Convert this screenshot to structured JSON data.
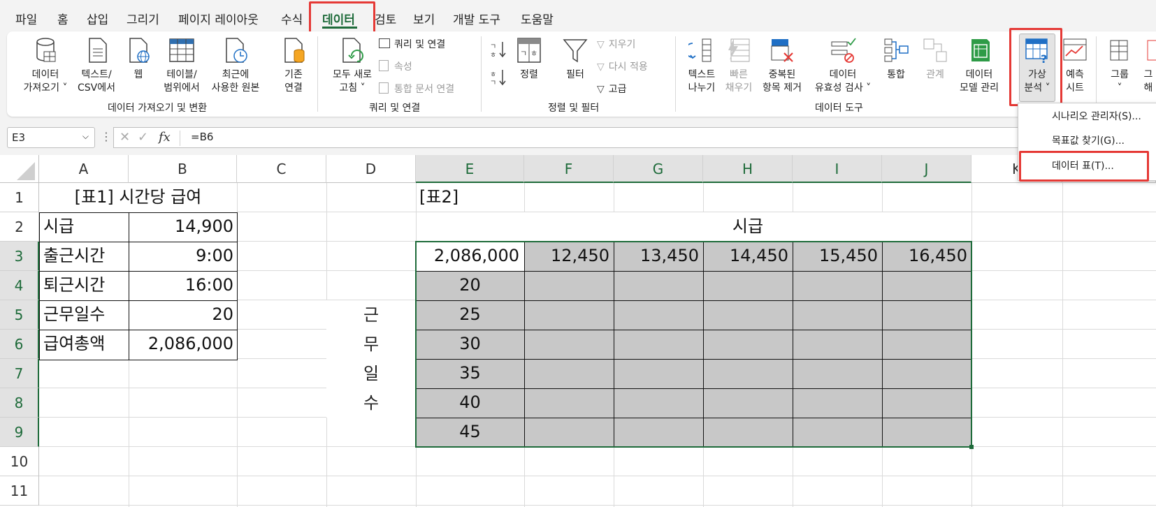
{
  "menu": {
    "tabs": [
      "파일",
      "홈",
      "삽입",
      "그리기",
      "페이지 레이아웃",
      "수식",
      "데이터",
      "검토",
      "보기",
      "개발 도구",
      "도움말"
    ],
    "active": "데이터"
  },
  "ribbon": {
    "get_data": {
      "l1": "데이터",
      "l2": "가져오기 ˅"
    },
    "text_csv": {
      "l1": "텍스트/",
      "l2": "CSV에서"
    },
    "web": {
      "l1": "웹"
    },
    "table_range": {
      "l1": "테이블/",
      "l2": "범위에서"
    },
    "recent": {
      "l1": "최근에",
      "l2": "사용한 원본"
    },
    "existing": {
      "l1": "기존",
      "l2": "연결"
    },
    "group1": "데이터 가져오기 및 변환",
    "refresh_all": {
      "l1": "모두 새로",
      "l2": "고침 ˅"
    },
    "queries": "쿼리 및 연결",
    "properties": "속성",
    "edit_links": "통합 문서 연결",
    "group2": "쿼리 및 연결",
    "sort": {
      "l1": "정렬"
    },
    "filter": {
      "l1": "필터"
    },
    "clear": "지우기",
    "reapply": "다시 적용",
    "advanced": "고급",
    "group3": "정렬 및 필터",
    "text_to_col": {
      "l1": "텍스트",
      "l2": "나누기"
    },
    "flash_fill": {
      "l1": "빠른",
      "l2": "채우기"
    },
    "remove_dup": {
      "l1": "중복된",
      "l2": "항목 제거"
    },
    "validation": {
      "l1": "데이터",
      "l2": "유효성 검사 ˅"
    },
    "consolidate": {
      "l1": "통합"
    },
    "relations": {
      "l1": "관계"
    },
    "data_model": {
      "l1": "데이터",
      "l2": "모델 관리"
    },
    "group4": "데이터 도구",
    "whatif": {
      "l1": "가상",
      "l2": "분석 ˅"
    },
    "forecast": {
      "l1": "예측",
      "l2": "시트"
    },
    "group_btn": {
      "l1": "그룹",
      "l2": "˅"
    },
    "ungroup": {
      "l1": "그",
      "l2": "해"
    }
  },
  "dropdown": {
    "items": [
      "시나리오 관리자(S)...",
      "목표값 찾기(G)...",
      "데이터 표(T)..."
    ]
  },
  "formula_bar": {
    "name_box": "E3",
    "fx": "fx",
    "formula": "=B6"
  },
  "sheet": {
    "columns": [
      "A",
      "B",
      "C",
      "D",
      "E",
      "F",
      "G",
      "H",
      "I",
      "J",
      "K"
    ],
    "rows": [
      "1",
      "2",
      "3",
      "4",
      "5",
      "6",
      "7",
      "8",
      "9",
      "10",
      "11"
    ],
    "a1": "[표1]  시간당 급여",
    "table1": [
      {
        "label": "시급",
        "value": "14,900"
      },
      {
        "label": "출근시간",
        "value": "9:00"
      },
      {
        "label": "퇴근시간",
        "value": "16:00"
      },
      {
        "label": "근무일수",
        "value": "20"
      },
      {
        "label": "급여총액",
        "value": "2,086,000"
      }
    ],
    "e1": "[표2]",
    "h2": "시급",
    "vertical_label": [
      "근",
      "무",
      "일",
      "수"
    ],
    "e3": "2,086,000",
    "wages": [
      "12,450",
      "13,450",
      "14,450",
      "15,450",
      "16,450"
    ],
    "days": [
      "20",
      "25",
      "30",
      "35",
      "40",
      "45"
    ]
  }
}
